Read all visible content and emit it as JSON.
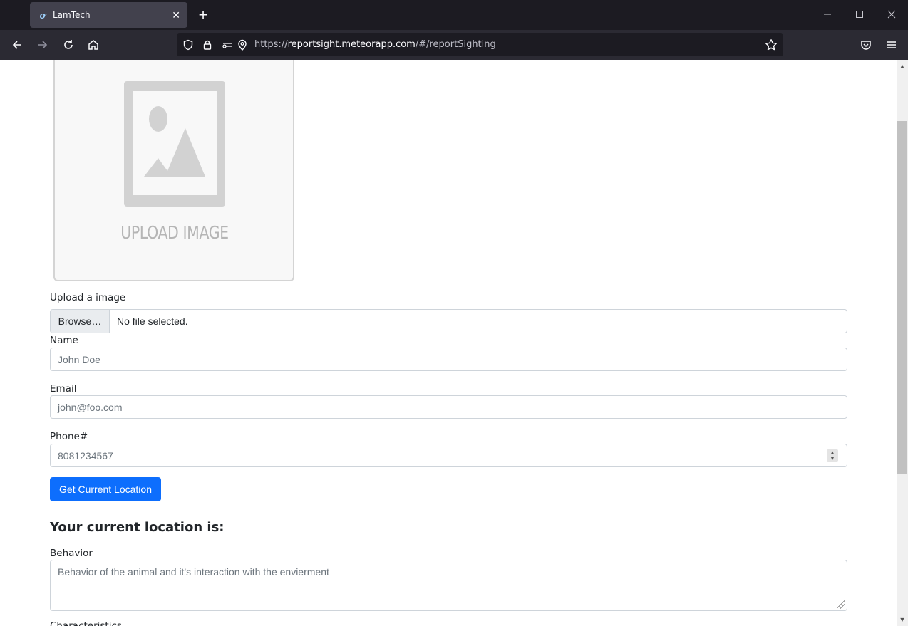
{
  "browser": {
    "tab_title": "LamTech",
    "tab_favicon": "ơ",
    "tab_close": "✕",
    "new_tab": "+",
    "url_prefix": "https://",
    "url_host": "reportsight.meteorapp.com",
    "url_path": "/#/reportSighting"
  },
  "upload": {
    "placeholder_text": "UPLOAD IMAGE",
    "label": "Upload a image",
    "browse_label": "Browse…",
    "file_status": "No file selected."
  },
  "form": {
    "name_label": "Name",
    "name_placeholder": "John Doe",
    "email_label": "Email",
    "email_placeholder": "john@foo.com",
    "phone_label": "Phone#",
    "phone_placeholder": "8081234567",
    "location_button": "Get Current Location",
    "location_heading": "Your current location is:",
    "behavior_label": "Behavior",
    "behavior_placeholder": "Behavior of the animal and it's interaction with the envierment",
    "next_label_partial": "Characteristics"
  },
  "colors": {
    "primary": "#0d6efd",
    "chrome_dark": "#1c1b22",
    "chrome_toolbar": "#2b2a33"
  }
}
